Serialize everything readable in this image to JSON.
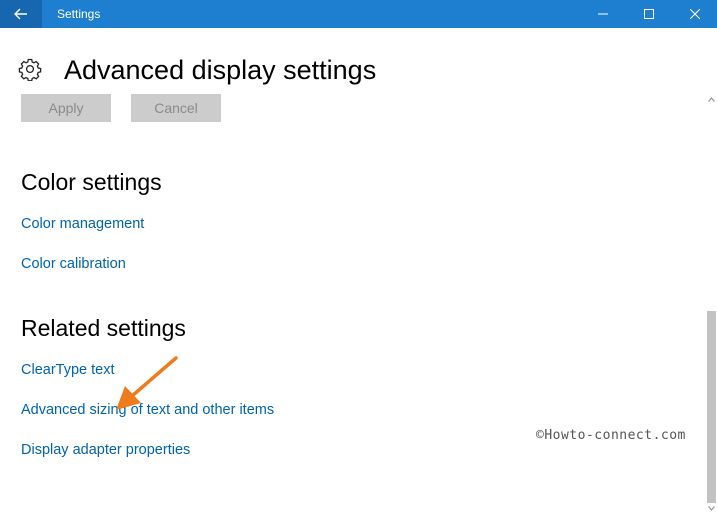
{
  "window": {
    "title": "Settings",
    "accent_color": "#1e7fd0",
    "icons": [
      "back-arrow-icon",
      "minimize-icon",
      "maximize-icon",
      "close-icon"
    ]
  },
  "header": {
    "icon": "gear-icon",
    "title": "Advanced display settings"
  },
  "buttons": {
    "apply_label": "Apply",
    "cancel_label": "Cancel"
  },
  "color_settings": {
    "heading": "Color settings",
    "links": [
      "Color management",
      "Color calibration"
    ]
  },
  "related_settings": {
    "heading": "Related settings",
    "links": [
      "ClearType text",
      "Advanced sizing of text and other items",
      "Display adapter properties"
    ]
  },
  "watermark": "©Howto-connect.com",
  "annotation_arrow_color": "#f07b1d",
  "link_color": "#0063b1"
}
